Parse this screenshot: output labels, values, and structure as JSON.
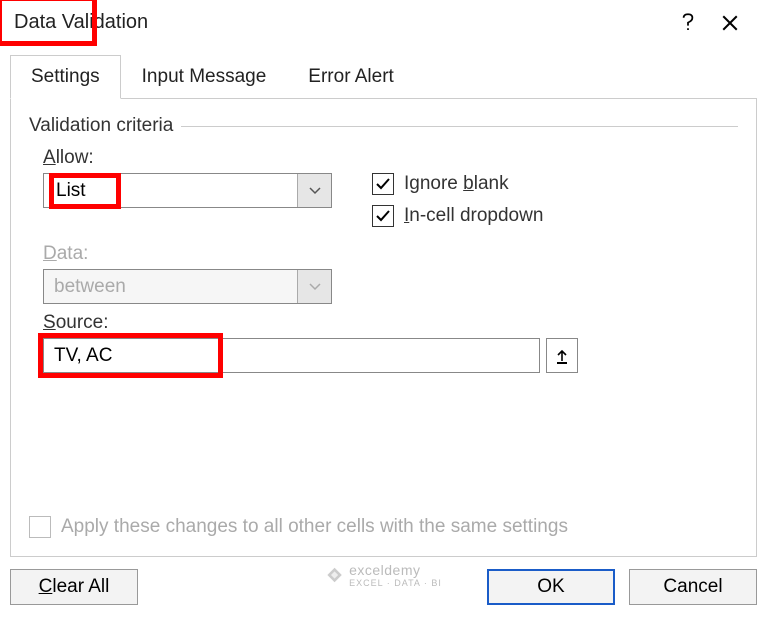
{
  "dialog": {
    "title": "Data Validation"
  },
  "tabs": {
    "settings": "Settings",
    "input_message": "Input Message",
    "error_alert": "Error Alert"
  },
  "criteria": {
    "legend": "Validation criteria",
    "allow_label_pre": "A",
    "allow_label_post": "llow:",
    "allow_value": "List",
    "data_label_pre": "D",
    "data_label_post": "ata:",
    "data_value": "between",
    "source_label_pre": "S",
    "source_label_post": "ource:",
    "source_value": "TV, AC"
  },
  "checks": {
    "ignore_blank_pre": "Ignore ",
    "ignore_blank_u": "b",
    "ignore_blank_post": "lank",
    "incell_pre": "I",
    "incell_post": "n-cell dropdown",
    "apply_label_pre": "Apply these changes to all other cells with the same settings"
  },
  "buttons": {
    "clear_all_pre": "C",
    "clear_all_post": "lear All",
    "ok": "OK",
    "cancel": "Cancel"
  },
  "watermark": {
    "brand": "exceldemy",
    "sub": "EXCEL · DATA · BI"
  }
}
